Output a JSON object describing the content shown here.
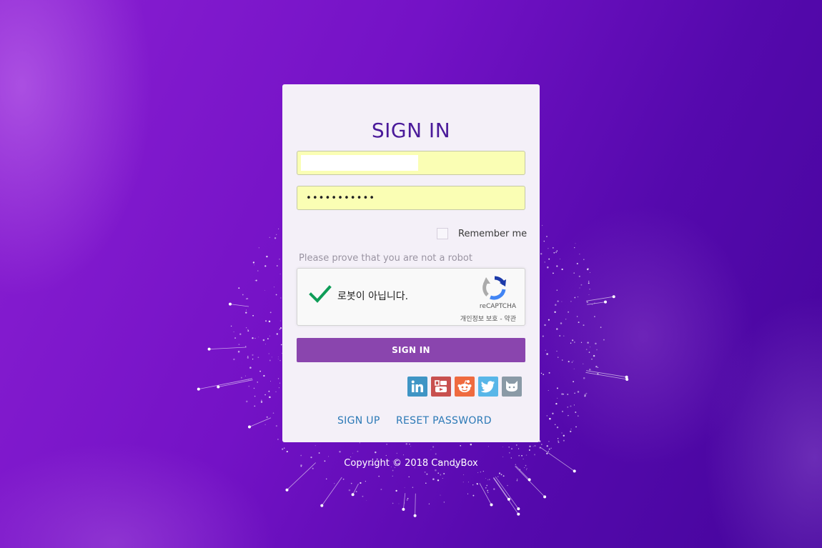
{
  "form": {
    "title": "SIGN IN",
    "username": {
      "value": "",
      "placeholder": ""
    },
    "password": {
      "value": "•••••••••••",
      "placeholder": ""
    },
    "remember_label": "Remember me",
    "remember_checked": false,
    "captcha_prompt": "Please prove that you are not a robot",
    "submit_label": "SIGN IN"
  },
  "recaptcha": {
    "label": "로봇이 아닙니다.",
    "brand": "reCAPTCHA",
    "links": "개인정보 보호 - 약관",
    "checked": true,
    "check_color": "#0f9d58"
  },
  "social": [
    {
      "name": "linkedin",
      "icon": "linkedin-icon",
      "color": "#3f95c5"
    },
    {
      "name": "youtube",
      "icon": "youtube-icon",
      "color": "#c8504f"
    },
    {
      "name": "reddit",
      "icon": "reddit-icon",
      "color": "#ef6a3f"
    },
    {
      "name": "twitter",
      "icon": "twitter-icon",
      "color": "#58b6e8"
    },
    {
      "name": "github",
      "icon": "github-icon",
      "color": "#8a9aa6"
    }
  ],
  "links": {
    "signup": "SIGN UP",
    "reset": "RESET PASSWORD"
  },
  "footer": {
    "copyright": "Copyright © 2018 CandyBox"
  },
  "colors": {
    "background": "#6a10c0",
    "card": "#f4f0f8",
    "title": "#4a1a9a",
    "input": "#fafeb4",
    "button": "#8a45ae",
    "link": "#2b79b6"
  }
}
